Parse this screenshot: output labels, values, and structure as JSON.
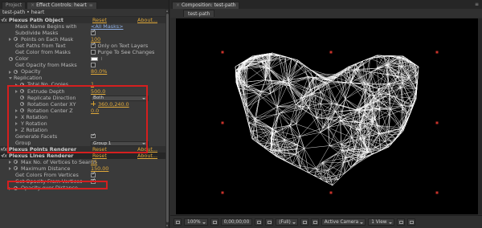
{
  "left_panel": {
    "tab_project": "Project",
    "tab_effect_controls": "Effect Controls: heart",
    "breadcrumb": "test-path • heart",
    "plexus_path_object": {
      "fx": "fx",
      "name": "Plexus Path Object",
      "reset": "Reset",
      "about": "About..."
    },
    "mask_name_begins_with": {
      "label": "Mask Name Begins with",
      "value": "<All Masks>"
    },
    "subdivide_masks": {
      "label": "Subdivide Masks"
    },
    "points_on_each_mask": {
      "label": "Points on Each Mask",
      "value": "100"
    },
    "get_paths_from_text": {
      "label": "Get Paths from Text",
      "checkbox_label": "Only on Text Layers"
    },
    "get_color_from_masks": {
      "label": "Get Color from Masks",
      "checkbox_label": "Purge To See Changes"
    },
    "color": {
      "label": "Color"
    },
    "get_opacity_from_masks": {
      "label": "Get Opacity from Masks"
    },
    "opacity": {
      "label": "Opacity",
      "value": "80.0%"
    },
    "replication": {
      "label": "Replication",
      "total_copies": {
        "label": "Total No. Copies",
        "value": "1"
      },
      "extrude_depth": {
        "label": "Extrude Depth",
        "value": "500.0"
      },
      "replicate_direction": {
        "label": "Replicate Direction",
        "value": "Both"
      },
      "rotation_center_xy": {
        "label": "Rotation Center XY",
        "value": "360.0,240.0"
      },
      "rotation_center_z": {
        "label": "Rotation Center Z",
        "value": "0.0"
      },
      "x_rotation": {
        "label": "X Rotation"
      },
      "y_rotation": {
        "label": "Y Rotation"
      },
      "z_rotation": {
        "label": "Z Rotation"
      }
    },
    "generate_facets": {
      "label": "Generate Facets"
    },
    "group": {
      "label": "Group",
      "value": "Group 1"
    },
    "plexus_points_renderer": {
      "fx": "fx",
      "name": "Plexus Points Renderer",
      "reset": "Reset",
      "about": "About..."
    },
    "plexus_lines_renderer": {
      "fx": "fx",
      "name": "Plexus Lines Renderer",
      "reset": "Reset",
      "about": "About..."
    },
    "max_vertices": {
      "label": "Max No. of Vertices to Search",
      "value": "15"
    },
    "maximum_distance": {
      "label": "Maximum Distance",
      "value": "150.00"
    },
    "get_colors_from_vertices": {
      "label": "Get Colors From Vertices"
    },
    "get_opacity_from_vertices": {
      "label": "Get Opacity From Vertices"
    },
    "opacity_over_distance": {
      "label": "Opacity over Distance"
    }
  },
  "right_panel": {
    "tab_composition": "Composition: test-path",
    "subtab": "test-path",
    "zoom": "100%",
    "timecode": "0;00;00;00",
    "resolution": "(Full)",
    "camera": "Active Camera",
    "view": "1 View"
  },
  "colors": {
    "panel_bg": "#3a3a3a",
    "link": "#e0a93a",
    "highlight_box": "#d51f1f",
    "viewer_bg": "#000000",
    "plexus_lines": "#ffffff"
  }
}
